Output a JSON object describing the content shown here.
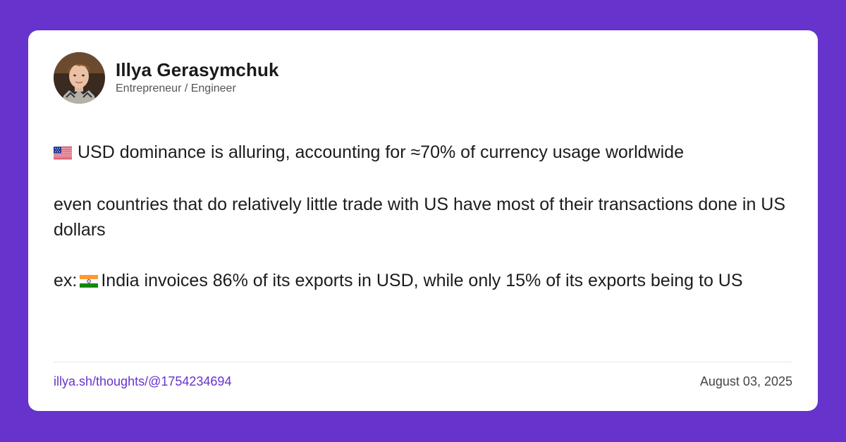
{
  "author": {
    "name": "Illya Gerasymchuk",
    "role": "Entrepreneur / Engineer"
  },
  "post": {
    "paragraph1": "USD dominance is alluring, accounting for ≈70% of currency usage worldwide",
    "paragraph2": "even countries that do relatively little trade with US have most of their transactions done in US dollars",
    "paragraph3_prefix": "ex:",
    "paragraph3_text": "India invoices 86% of its exports in USD, while only 15% of its exports being to US",
    "flag1": "us-flag-icon",
    "flag2": "india-flag-icon"
  },
  "footer": {
    "link": "illya.sh/thoughts/@1754234694",
    "date": "August 03, 2025"
  },
  "colors": {
    "background": "#6633cc",
    "card": "#ffffff",
    "link": "#6633cc",
    "text": "#1c1c1c"
  }
}
